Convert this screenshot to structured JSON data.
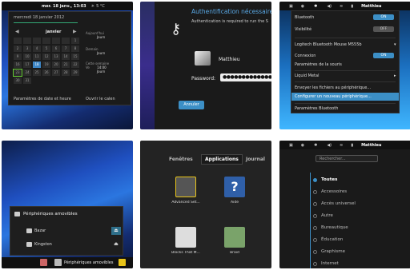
{
  "tile1": {
    "topbar_date": "mer. 18 janv., 13:03",
    "topbar_temp": "5 °C",
    "cal_date": "mercredi 18 janvier 2012",
    "month": "janvier",
    "days": [
      "1",
      "2",
      "3",
      "4",
      "5",
      "6",
      "7",
      "8",
      "9",
      "10",
      "11",
      "12",
      "13",
      "14",
      "15",
      "16",
      "17",
      "18",
      "19",
      "20",
      "21",
      "22",
      "23",
      "24",
      "25",
      "26",
      "27",
      "28",
      "29",
      "30",
      "31"
    ],
    "side": [
      {
        "h": "Aujourd'hui",
        "v": "Journ"
      },
      {
        "h": "Demain",
        "v": "Journ"
      },
      {
        "h": "Cette semaine",
        "v": "Journ"
      },
      {
        "h": "Ve",
        "v": "14:00"
      }
    ],
    "footer": "Paramètres de date et heure",
    "footer2": "Ouvrir le calen"
  },
  "tile2": {
    "title": "Authentification nécessaire",
    "text": "Authentication is required to run the S",
    "user": "Matthieu",
    "pw_label": "Password:",
    "pw_value": "●●●●●●●●●●●●●●●●●",
    "cancel": "Annuler"
  },
  "tile3": {
    "user": "Matthieu",
    "bluetooth": "Bluetooth",
    "visibilite": "Visibilité",
    "on": "ON",
    "off": "OFF",
    "device": "Logitech Bluetooth Mouse M555b",
    "connexion": "Connexion",
    "mouse_settings": "Paramètres de la souris",
    "liquid": "Liquid Metal",
    "send": "Envoyer les fichiers au périphérique...",
    "configure": "Configurer un nouveau périphérique...",
    "bt_settings": "Paramètres Bluetooth"
  },
  "tile4": {
    "title": "Périphériques amovibles",
    "items": [
      "Bazar",
      "Kingston"
    ],
    "taskbar": "Périphériques amovibles"
  },
  "tile5": {
    "tabs": [
      "Fenêtres",
      "Applications",
      "Journal"
    ],
    "apps": [
      "Advanced Set...",
      "Aide",
      "Blocks That M...",
      "Braid"
    ]
  },
  "tile6": {
    "user": "Matthieu",
    "search_placeholder": "Rechercher...",
    "categories": [
      "Toutes",
      "Accessoires",
      "Accès universel",
      "Autre",
      "Bureautique",
      "Éducation",
      "Graphisme",
      "Internet"
    ]
  }
}
